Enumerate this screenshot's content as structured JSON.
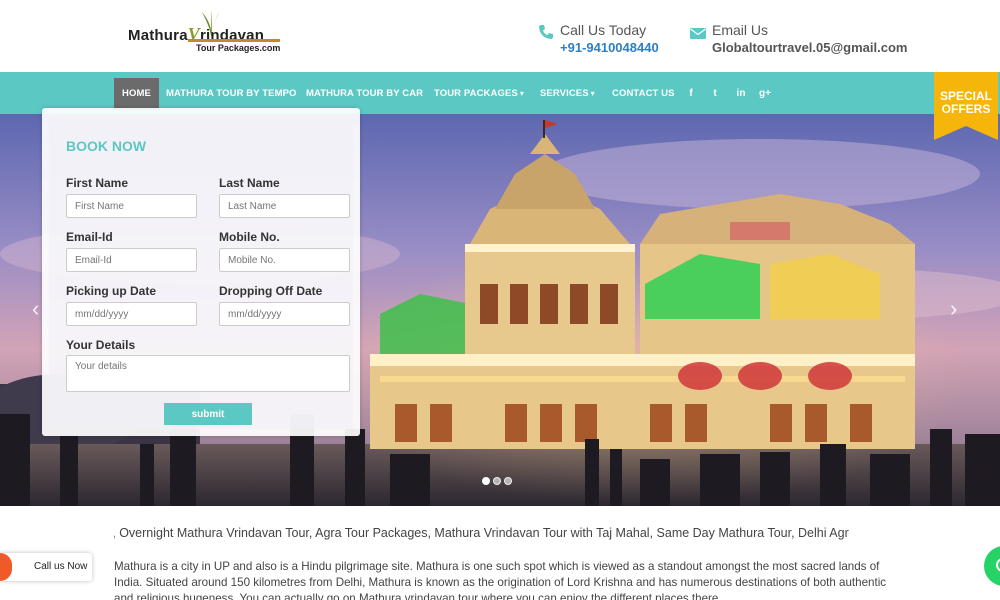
{
  "header": {
    "logo_main_1": "Mathura",
    "logo_main_v": "V",
    "logo_main_2": "rindavan",
    "logo_sub": "Tour Packages.com",
    "phone_label": "Call Us Today",
    "phone_value": "+91-9410048440",
    "email_label": "Email Us",
    "email_value": "Globaltourtravel.05@gmail.com",
    "icons": {
      "phone": "phone-icon",
      "email": "envelope-icon"
    }
  },
  "nav": {
    "items": [
      {
        "label": "HOME",
        "active": true
      },
      {
        "label": "MATHURA TOUR BY TEMPO"
      },
      {
        "label": "MATHURA TOUR BY CAR"
      },
      {
        "label": "TOUR PACKAGES",
        "has_dropdown": true
      },
      {
        "label": "SERVICES",
        "has_dropdown": true
      },
      {
        "label": "CONTACT US"
      }
    ],
    "social": [
      {
        "glyph": "f",
        "icon": "facebook-icon"
      },
      {
        "glyph": "t",
        "icon": "twitter-icon"
      },
      {
        "glyph": "in",
        "icon": "linkedin-icon"
      },
      {
        "glyph": "g+",
        "icon": "google-plus-icon"
      }
    ],
    "special_line1": "SPECIAL",
    "special_line2": "OFFERS"
  },
  "booking": {
    "title": "BOOK NOW",
    "first_name_label": "First Name",
    "first_name_placeholder": "First Name",
    "last_name_label": "Last Name",
    "last_name_placeholder": "Last Name",
    "email_label": "Email-Id",
    "email_placeholder": "Email-Id",
    "mobile_label": "Mobile No.",
    "mobile_placeholder": "Mobile No.",
    "pickup_label": "Picking up Date",
    "pickup_placeholder": "mm/dd/yyyy",
    "dropoff_label": "Dropping Off Date",
    "dropoff_placeholder": "mm/dd/yyyy",
    "details_label": "Your Details",
    "details_placeholder": "Your details",
    "submit_label": "submit"
  },
  "slider": {
    "slide_count": 3,
    "active_index": 0,
    "prev_glyph": "‹",
    "next_glyph": "›"
  },
  "marquee_text": "s, Overnight Mathura Vrindavan Tour, Agra Tour Packages, Mathura Vrindavan Tour with Taj Mahal, Same Day Mathura Tour, Delhi Agr",
  "description": "Mathura is a city in UP and also is a Hindu pilgrimage site. Mathura is one such spot which is viewed as a standout amongst the most sacred lands of India. Situated around 150 kilometres from Delhi, Mathura is known as the origination of Lord Krishna and has numerous destinations of both authentic and religious hugeness. You can actually go on Mathura vrindavan tour where you can enjoy the different places there.",
  "floating": {
    "call_now": "Call us Now"
  },
  "colors": {
    "accent": "#5bc8c4",
    "nav_active": "#6b6b6b",
    "phone": "#2d7fc1",
    "special": "#f5b50a"
  }
}
